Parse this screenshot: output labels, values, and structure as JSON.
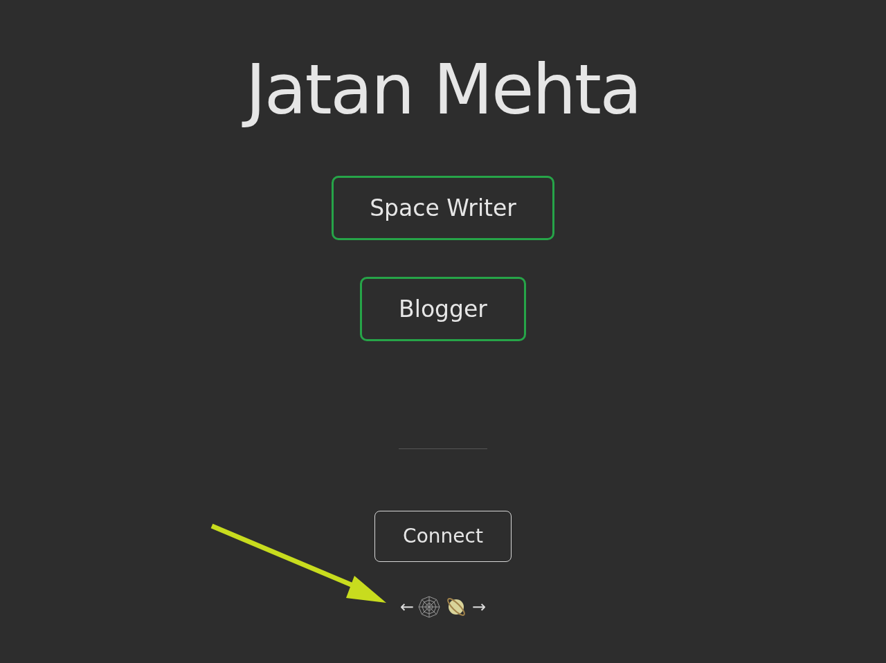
{
  "title": "Jatan Mehta",
  "roles": [
    {
      "label": "Space Writer"
    },
    {
      "label": "Blogger"
    }
  ],
  "connect": {
    "label": "Connect"
  },
  "webring": {
    "prev": "←",
    "next": "→"
  }
}
